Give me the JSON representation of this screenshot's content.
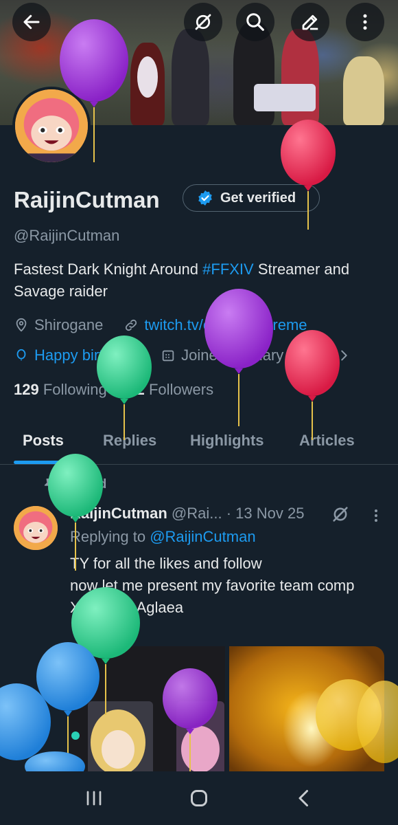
{
  "profile": {
    "name": "RaijinCutman",
    "handle": "@RaijinCutman",
    "get_verified_label": "Get verified",
    "bio_part1": "Fastest Dark Knight Around ",
    "bio_hashtag": "#FFXIV",
    "bio_part2": " Streamer and Savage raider",
    "location": "Shirogane",
    "website": "twitch.tv/cutman_xtreme",
    "birthday": "Happy birthday!",
    "joined": "Joined January 2014",
    "following_count": "129",
    "following_label": "Following",
    "followers_count": "212",
    "followers_label": "Followers"
  },
  "tabs": [
    {
      "label": "Posts",
      "active": true
    },
    {
      "label": "Replies",
      "active": false
    },
    {
      "label": "Highlights",
      "active": false
    },
    {
      "label": "Articles",
      "active": false
    }
  ],
  "post": {
    "pinned_label": "Pinned",
    "author": "RaijinCutman",
    "handle_truncated": "@Rai...",
    "date": "· 13 Nov 25",
    "replying_prefix": "Replying to ",
    "replying_to": "@RaijinCutman",
    "text_line1": "TY for all the likes and follow",
    "text_line2": "now let me present my favorite team comp",
    "text_line3": "Xianzhou Aglaea"
  },
  "icons": {
    "back": "back-arrow-icon",
    "grok": "grok-icon",
    "search": "search-icon",
    "edit": "compose-icon",
    "more": "more-vertical-icon",
    "verified": "verified-badge-icon",
    "location": "location-icon",
    "link": "link-icon",
    "birthday": "balloon-icon",
    "calendar": "calendar-icon",
    "pin": "pin-icon"
  },
  "colors": {
    "background": "#15202b",
    "accent": "#1d9bf0",
    "muted": "#8b98a5",
    "text": "#e7e9ea",
    "balloon_purple": "#9b30d9",
    "balloon_red": "#e8264f",
    "balloon_green": "#2fd18a",
    "balloon_blue": "#2f8fe0",
    "balloon_yellow": "#f0c418"
  }
}
